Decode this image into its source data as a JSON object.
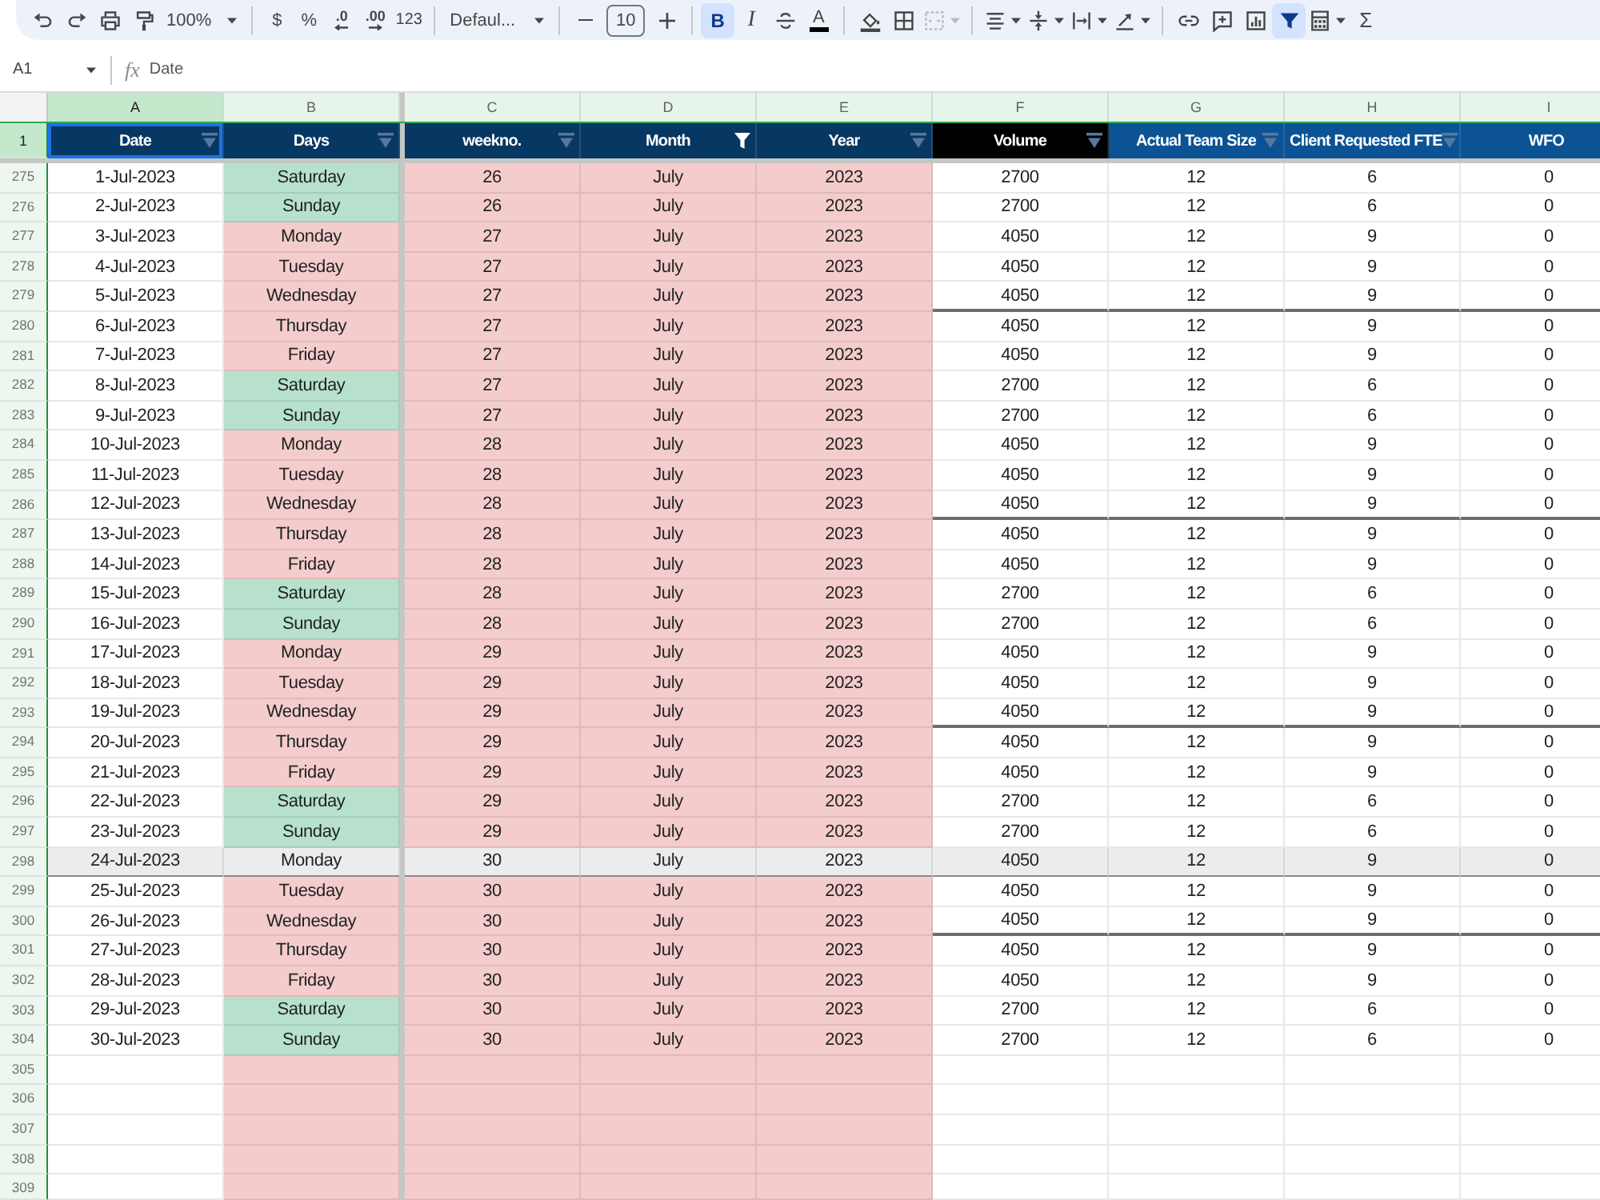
{
  "toolbar": {
    "groups": [
      [
        {
          "kind": "undo",
          "on": false,
          "disabled": false,
          "menu": false
        },
        {
          "kind": "redo",
          "on": false,
          "disabled": false,
          "menu": false
        },
        {
          "kind": "print",
          "on": false,
          "disabled": false,
          "menu": false
        },
        {
          "kind": "paint_format",
          "on": false,
          "disabled": false,
          "menu": false
        },
        {
          "kind": "zoom",
          "label": "100%",
          "on": false,
          "disabled": false,
          "menu": true
        }
      ],
      [
        {
          "kind": "currency",
          "label": "$",
          "on": false,
          "disabled": false,
          "menu": false
        },
        {
          "kind": "percent",
          "label": "%",
          "on": false,
          "disabled": false,
          "menu": false
        },
        {
          "kind": "decimal_less",
          "label": ".0",
          "on": false,
          "disabled": false,
          "menu": false
        },
        {
          "kind": "decimal_more",
          "label": ".00",
          "on": false,
          "disabled": false,
          "menu": false
        },
        {
          "kind": "number_format",
          "label": "123",
          "on": false,
          "disabled": false,
          "menu": false
        }
      ],
      [
        {
          "kind": "font",
          "label": "Defaul...",
          "on": false,
          "disabled": false,
          "menu": true
        }
      ],
      [
        {
          "kind": "minus",
          "on": false,
          "disabled": false,
          "menu": false
        },
        {
          "kind": "size",
          "label": "10",
          "on": false,
          "disabled": false,
          "menu": false
        },
        {
          "kind": "plus",
          "on": false,
          "disabled": false,
          "menu": false
        }
      ],
      [
        {
          "kind": "bold",
          "label": "B",
          "on": true,
          "disabled": false,
          "menu": false
        },
        {
          "kind": "italic",
          "label": "I",
          "on": false,
          "disabled": false,
          "menu": false
        },
        {
          "kind": "strike",
          "on": false,
          "disabled": false,
          "menu": false
        },
        {
          "kind": "text_color",
          "label": "A",
          "on": false,
          "disabled": false,
          "menu": false
        }
      ],
      [
        {
          "kind": "fill",
          "on": false,
          "disabled": false,
          "menu": false
        },
        {
          "kind": "borders",
          "on": false,
          "disabled": false,
          "menu": false
        },
        {
          "kind": "merge",
          "on": false,
          "disabled": true,
          "menu": true
        }
      ],
      [
        {
          "kind": "halign",
          "on": false,
          "disabled": false,
          "menu": true
        },
        {
          "kind": "valign",
          "on": false,
          "disabled": false,
          "menu": true
        },
        {
          "kind": "wrap",
          "on": false,
          "disabled": false,
          "menu": true
        },
        {
          "kind": "rotate",
          "on": false,
          "disabled": false,
          "menu": true
        }
      ],
      [
        {
          "kind": "link",
          "on": false,
          "disabled": false,
          "menu": false
        },
        {
          "kind": "comment",
          "on": false,
          "disabled": false,
          "menu": false
        },
        {
          "kind": "chart",
          "on": false,
          "disabled": false,
          "menu": false
        },
        {
          "kind": "filter",
          "on": true,
          "disabled": false,
          "menu": false
        },
        {
          "kind": "functions",
          "on": false,
          "disabled": false,
          "menu": true
        },
        {
          "kind": "sum",
          "label": "Σ",
          "on": false,
          "disabled": false,
          "menu": false
        }
      ]
    ]
  },
  "formula_bar": {
    "cell_ref": "A1",
    "function_symbol": "fx",
    "formula": "Date"
  },
  "sheet": {
    "columns": [
      {
        "letter": "A",
        "header": "Date",
        "selected": true,
        "frozen": true,
        "kind": "plain",
        "color": "#073763",
        "filter": true,
        "filtered": false
      },
      {
        "letter": "B",
        "header": "Days",
        "selected": false,
        "frozen": true,
        "kind": "day",
        "color": "#073763",
        "filter": true,
        "filtered": false
      },
      {
        "letter": "C",
        "header": "weekno.",
        "selected": false,
        "frozen": false,
        "kind": "shaded",
        "color": "#073763",
        "filter": true,
        "filtered": false
      },
      {
        "letter": "D",
        "header": "Month",
        "selected": false,
        "frozen": false,
        "kind": "shaded",
        "color": "#073763",
        "filter": true,
        "filtered": true
      },
      {
        "letter": "E",
        "header": "Year",
        "selected": false,
        "frozen": false,
        "kind": "shaded",
        "color": "#073763",
        "filter": true,
        "filtered": false
      },
      {
        "letter": "F",
        "header": "Volume",
        "selected": false,
        "frozen": false,
        "kind": "plain",
        "color": "#000000",
        "filter": true,
        "filtered": false
      },
      {
        "letter": "G",
        "header": "Actual Team Size",
        "selected": false,
        "frozen": false,
        "kind": "plain",
        "color": "#0b5394",
        "filter": true,
        "filtered": false
      },
      {
        "letter": "H",
        "header": "Client Requested FTE",
        "selected": false,
        "frozen": false,
        "kind": "plain",
        "color": "#0b5394",
        "filter": true,
        "filtered": false
      },
      {
        "letter": "I",
        "header": "WFO",
        "selected": false,
        "frozen": false,
        "kind": "plain",
        "color": "#0b5394",
        "filter": false,
        "filtered": false
      }
    ],
    "header_row": {
      "number": "1",
      "selected": true
    },
    "rows": [
      {
        "number": "275",
        "cells": [
          "1-Jul-2023",
          "Saturday",
          "26",
          "July",
          "2023",
          "2700",
          "12",
          "6",
          "0"
        ],
        "weekend": true,
        "selected": false,
        "rule_below": false
      },
      {
        "number": "276",
        "cells": [
          "2-Jul-2023",
          "Sunday",
          "26",
          "July",
          "2023",
          "2700",
          "12",
          "6",
          "0"
        ],
        "weekend": true,
        "selected": false,
        "rule_below": false
      },
      {
        "number": "277",
        "cells": [
          "3-Jul-2023",
          "Monday",
          "27",
          "July",
          "2023",
          "4050",
          "12",
          "9",
          "0"
        ],
        "weekend": false,
        "selected": false,
        "rule_below": false
      },
      {
        "number": "278",
        "cells": [
          "4-Jul-2023",
          "Tuesday",
          "27",
          "July",
          "2023",
          "4050",
          "12",
          "9",
          "0"
        ],
        "weekend": false,
        "selected": false,
        "rule_below": false
      },
      {
        "number": "279",
        "cells": [
          "5-Jul-2023",
          "Wednesday",
          "27",
          "July",
          "2023",
          "4050",
          "12",
          "9",
          "0"
        ],
        "weekend": false,
        "selected": false,
        "rule_below": true
      },
      {
        "number": "280",
        "cells": [
          "6-Jul-2023",
          "Thursday",
          "27",
          "July",
          "2023",
          "4050",
          "12",
          "9",
          "0"
        ],
        "weekend": false,
        "selected": false,
        "rule_below": false
      },
      {
        "number": "281",
        "cells": [
          "7-Jul-2023",
          "Friday",
          "27",
          "July",
          "2023",
          "4050",
          "12",
          "9",
          "0"
        ],
        "weekend": false,
        "selected": false,
        "rule_below": false
      },
      {
        "number": "282",
        "cells": [
          "8-Jul-2023",
          "Saturday",
          "27",
          "July",
          "2023",
          "2700",
          "12",
          "6",
          "0"
        ],
        "weekend": true,
        "selected": false,
        "rule_below": false
      },
      {
        "number": "283",
        "cells": [
          "9-Jul-2023",
          "Sunday",
          "27",
          "July",
          "2023",
          "2700",
          "12",
          "6",
          "0"
        ],
        "weekend": true,
        "selected": false,
        "rule_below": false
      },
      {
        "number": "284",
        "cells": [
          "10-Jul-2023",
          "Monday",
          "28",
          "July",
          "2023",
          "4050",
          "12",
          "9",
          "0"
        ],
        "weekend": false,
        "selected": false,
        "rule_below": false
      },
      {
        "number": "285",
        "cells": [
          "11-Jul-2023",
          "Tuesday",
          "28",
          "July",
          "2023",
          "4050",
          "12",
          "9",
          "0"
        ],
        "weekend": false,
        "selected": false,
        "rule_below": false
      },
      {
        "number": "286",
        "cells": [
          "12-Jul-2023",
          "Wednesday",
          "28",
          "July",
          "2023",
          "4050",
          "12",
          "9",
          "0"
        ],
        "weekend": false,
        "selected": false,
        "rule_below": true
      },
      {
        "number": "287",
        "cells": [
          "13-Jul-2023",
          "Thursday",
          "28",
          "July",
          "2023",
          "4050",
          "12",
          "9",
          "0"
        ],
        "weekend": false,
        "selected": false,
        "rule_below": false
      },
      {
        "number": "288",
        "cells": [
          "14-Jul-2023",
          "Friday",
          "28",
          "July",
          "2023",
          "4050",
          "12",
          "9",
          "0"
        ],
        "weekend": false,
        "selected": false,
        "rule_below": false
      },
      {
        "number": "289",
        "cells": [
          "15-Jul-2023",
          "Saturday",
          "28",
          "July",
          "2023",
          "2700",
          "12",
          "6",
          "0"
        ],
        "weekend": true,
        "selected": false,
        "rule_below": false
      },
      {
        "number": "290",
        "cells": [
          "16-Jul-2023",
          "Sunday",
          "28",
          "July",
          "2023",
          "2700",
          "12",
          "6",
          "0"
        ],
        "weekend": true,
        "selected": false,
        "rule_below": false
      },
      {
        "number": "291",
        "cells": [
          "17-Jul-2023",
          "Monday",
          "29",
          "July",
          "2023",
          "4050",
          "12",
          "9",
          "0"
        ],
        "weekend": false,
        "selected": false,
        "rule_below": false
      },
      {
        "number": "292",
        "cells": [
          "18-Jul-2023",
          "Tuesday",
          "29",
          "July",
          "2023",
          "4050",
          "12",
          "9",
          "0"
        ],
        "weekend": false,
        "selected": false,
        "rule_below": false
      },
      {
        "number": "293",
        "cells": [
          "19-Jul-2023",
          "Wednesday",
          "29",
          "July",
          "2023",
          "4050",
          "12",
          "9",
          "0"
        ],
        "weekend": false,
        "selected": false,
        "rule_below": true
      },
      {
        "number": "294",
        "cells": [
          "20-Jul-2023",
          "Thursday",
          "29",
          "July",
          "2023",
          "4050",
          "12",
          "9",
          "0"
        ],
        "weekend": false,
        "selected": false,
        "rule_below": false
      },
      {
        "number": "295",
        "cells": [
          "21-Jul-2023",
          "Friday",
          "29",
          "July",
          "2023",
          "4050",
          "12",
          "9",
          "0"
        ],
        "weekend": false,
        "selected": false,
        "rule_below": false
      },
      {
        "number": "296",
        "cells": [
          "22-Jul-2023",
          "Saturday",
          "29",
          "July",
          "2023",
          "2700",
          "12",
          "6",
          "0"
        ],
        "weekend": true,
        "selected": false,
        "rule_below": false
      },
      {
        "number": "297",
        "cells": [
          "23-Jul-2023",
          "Sunday",
          "29",
          "July",
          "2023",
          "2700",
          "12",
          "6",
          "0"
        ],
        "weekend": true,
        "selected": false,
        "rule_below": false
      },
      {
        "number": "298",
        "cells": [
          "24-Jul-2023",
          "Monday",
          "30",
          "July",
          "2023",
          "4050",
          "12",
          "9",
          "0"
        ],
        "weekend": false,
        "selected": true,
        "rule_below": false
      },
      {
        "number": "299",
        "cells": [
          "25-Jul-2023",
          "Tuesday",
          "30",
          "July",
          "2023",
          "4050",
          "12",
          "9",
          "0"
        ],
        "weekend": false,
        "selected": false,
        "rule_below": false
      },
      {
        "number": "300",
        "cells": [
          "26-Jul-2023",
          "Wednesday",
          "30",
          "July",
          "2023",
          "4050",
          "12",
          "9",
          "0"
        ],
        "weekend": false,
        "selected": false,
        "rule_below": true
      },
      {
        "number": "301",
        "cells": [
          "27-Jul-2023",
          "Thursday",
          "30",
          "July",
          "2023",
          "4050",
          "12",
          "9",
          "0"
        ],
        "weekend": false,
        "selected": false,
        "rule_below": false
      },
      {
        "number": "302",
        "cells": [
          "28-Jul-2023",
          "Friday",
          "30",
          "July",
          "2023",
          "4050",
          "12",
          "9",
          "0"
        ],
        "weekend": false,
        "selected": false,
        "rule_below": false
      },
      {
        "number": "303",
        "cells": [
          "29-Jul-2023",
          "Saturday",
          "30",
          "July",
          "2023",
          "2700",
          "12",
          "6",
          "0"
        ],
        "weekend": true,
        "selected": false,
        "rule_below": false
      },
      {
        "number": "304",
        "cells": [
          "30-Jul-2023",
          "Sunday",
          "30",
          "July",
          "2023",
          "2700",
          "12",
          "6",
          "0"
        ],
        "weekend": true,
        "selected": false,
        "rule_below": false
      }
    ],
    "empty_rows": [
      "305",
      "306",
      "307",
      "308",
      "309"
    ]
  }
}
